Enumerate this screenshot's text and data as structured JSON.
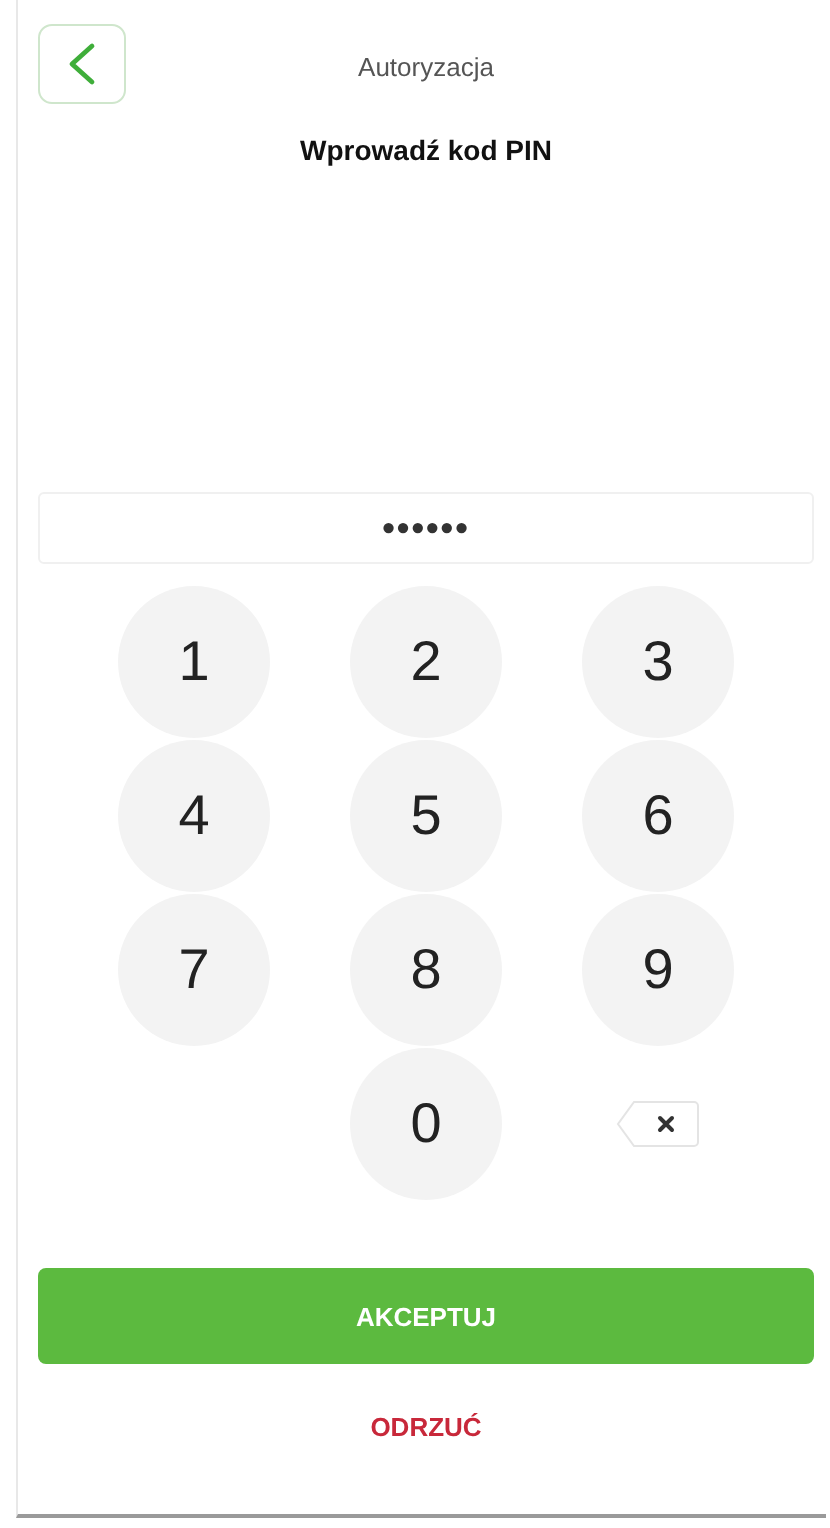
{
  "header": {
    "title": "Autoryzacja",
    "subtitle": "Wprowadź kod PIN"
  },
  "pin_field": {
    "value": "••••••"
  },
  "keypad": [
    {
      "kind": "digit",
      "label": "1"
    },
    {
      "kind": "digit",
      "label": "2"
    },
    {
      "kind": "digit",
      "label": "3"
    },
    {
      "kind": "digit",
      "label": "4"
    },
    {
      "kind": "digit",
      "label": "5"
    },
    {
      "kind": "digit",
      "label": "6"
    },
    {
      "kind": "digit",
      "label": "7"
    },
    {
      "kind": "digit",
      "label": "8"
    },
    {
      "kind": "digit",
      "label": "9"
    },
    {
      "kind": "blank"
    },
    {
      "kind": "digit",
      "label": "0"
    },
    {
      "kind": "backspace"
    }
  ],
  "buttons": [
    {
      "kind": "primary",
      "label": "AKCEPTUJ"
    },
    {
      "kind": "text",
      "label": "ODRZUĆ"
    }
  ]
}
